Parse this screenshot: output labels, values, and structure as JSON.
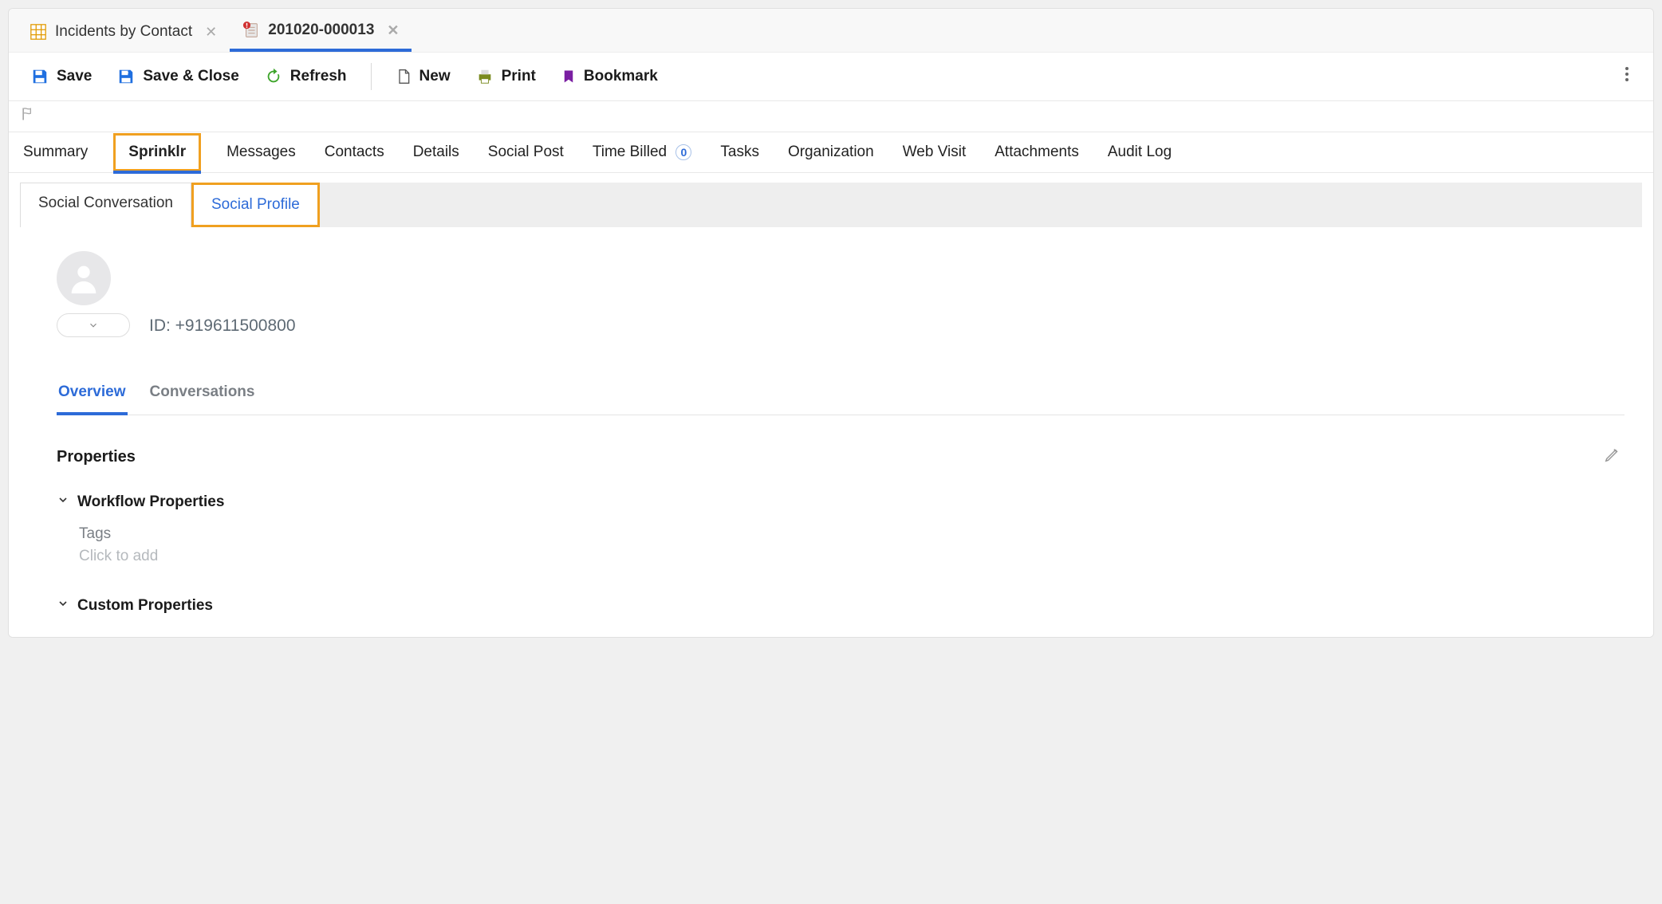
{
  "top_tabs": [
    {
      "label": "Incidents by Contact",
      "active": false
    },
    {
      "label": "201020-000013",
      "active": true
    }
  ],
  "toolbar": {
    "save": "Save",
    "save_close": "Save & Close",
    "refresh": "Refresh",
    "new": "New",
    "print": "Print",
    "bookmark": "Bookmark"
  },
  "secondary_nav": {
    "items": [
      {
        "label": "Summary"
      },
      {
        "label": "Sprinklr",
        "highlighted": true
      },
      {
        "label": "Messages"
      },
      {
        "label": "Contacts"
      },
      {
        "label": "Details"
      },
      {
        "label": "Social Post"
      },
      {
        "label": "Time Billed",
        "badge": "0"
      },
      {
        "label": "Tasks"
      },
      {
        "label": "Organization"
      },
      {
        "label": "Web Visit"
      },
      {
        "label": "Attachments"
      },
      {
        "label": "Audit Log"
      }
    ]
  },
  "social_subtabs": [
    {
      "label": "Social Conversation"
    },
    {
      "label": "Social Profile",
      "highlighted": true
    }
  ],
  "profile": {
    "id_label": "ID: +919611500800"
  },
  "profile_tabs": [
    {
      "label": "Overview",
      "active": true
    },
    {
      "label": "Conversations",
      "active": false
    }
  ],
  "properties": {
    "title": "Properties",
    "groups": [
      {
        "title": "Workflow Properties",
        "fields": [
          {
            "label": "Tags",
            "placeholder": "Click to add"
          }
        ]
      },
      {
        "title": "Custom Properties",
        "fields": []
      }
    ]
  }
}
